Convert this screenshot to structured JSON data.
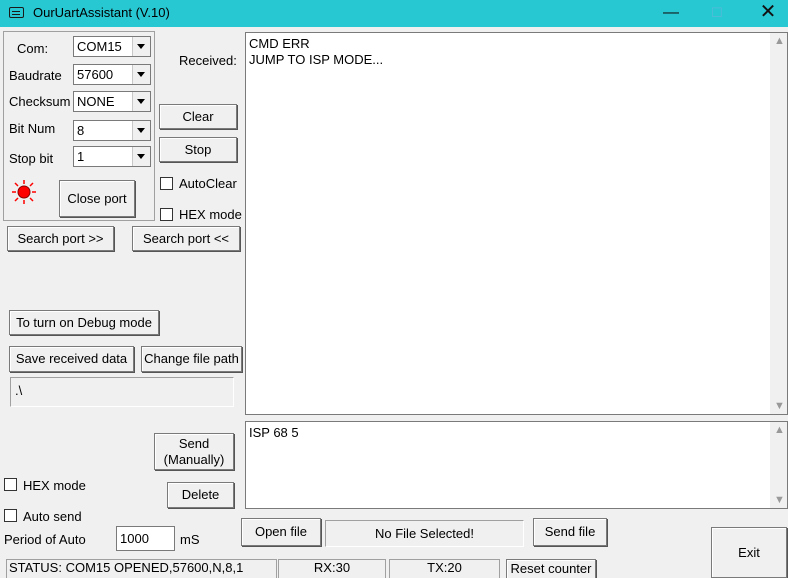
{
  "window": {
    "title": "OurUartAssistant (V.10)",
    "min": "—",
    "max": "☐",
    "close": "✕"
  },
  "settings": {
    "com_label": "Com:",
    "com_value": "COM15",
    "baud_label": "Baudrate",
    "baud_value": "57600",
    "checksum_label": "Checksum",
    "checksum_value": "NONE",
    "bitnum_label": "Bit Num",
    "bitnum_value": "8",
    "stopbit_label": "Stop bit",
    "stopbit_value": "1",
    "close_port": "Close port"
  },
  "receive": {
    "label": "Received:",
    "clear": "Clear",
    "stop": "Stop",
    "autoclear": "AutoClear",
    "hexmode": "HEX mode",
    "content": "CMD ERR\nJUMP TO ISP MODE..."
  },
  "search": {
    "forward": "Search port >>",
    "backward": "Search port <<"
  },
  "debug": {
    "button": "To turn on Debug mode"
  },
  "save": {
    "save_button": "Save received data",
    "change_path": "Change file path",
    "path_value": ".\\"
  },
  "send": {
    "content": "ISP 68 5",
    "send_manual": "Send\n(Manually)",
    "delete": "Delete",
    "hexmode": "HEX mode",
    "autosend": "Auto send",
    "period_label": "Period of Auto",
    "period_value": "1000",
    "period_unit": "mS"
  },
  "file": {
    "open": "Open file",
    "selected": "No File Selected!",
    "send": "Send file"
  },
  "exit": "Exit",
  "status": {
    "text": "STATUS: COM15 OPENED,57600,N,8,1",
    "rx": "RX:30",
    "tx": "TX:20",
    "reset": "Reset counter"
  },
  "colors": {
    "titlebar": "#28c8d3",
    "indicator": "#ff0000"
  }
}
